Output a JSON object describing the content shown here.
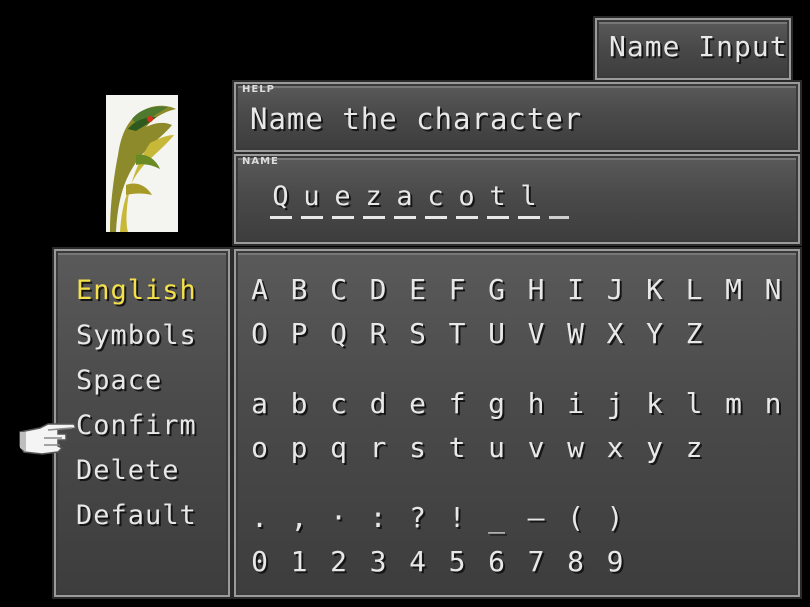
{
  "title": {
    "label": "Name Input"
  },
  "help": {
    "tag": "HELP",
    "text": "Name the character"
  },
  "name": {
    "tag": "NAME",
    "chars": [
      "Q",
      "u",
      "e",
      "z",
      "a",
      "c",
      "o",
      "t",
      "l",
      ""
    ]
  },
  "menu": {
    "items": [
      {
        "label": "English",
        "active": true
      },
      {
        "label": "Symbols",
        "active": false
      },
      {
        "label": "Space",
        "active": false
      },
      {
        "label": "Confirm",
        "active": false
      },
      {
        "label": "Delete",
        "active": false
      },
      {
        "label": "Default",
        "active": false
      }
    ],
    "cursor_on": "Confirm"
  },
  "grid": {
    "rows": [
      [
        "A",
        "B",
        "C",
        "D",
        "E",
        "F",
        "G",
        "H",
        "I",
        "J",
        "K",
        "L",
        "M",
        "N"
      ],
      [
        "O",
        "P",
        "Q",
        "R",
        "S",
        "T",
        "U",
        "V",
        "W",
        "X",
        "Y",
        "Z"
      ],
      [
        "a",
        "b",
        "c",
        "d",
        "e",
        "f",
        "g",
        "h",
        "i",
        "j",
        "k",
        "l",
        "m",
        "n"
      ],
      [
        "o",
        "p",
        "q",
        "r",
        "s",
        "t",
        "u",
        "v",
        "w",
        "x",
        "y",
        "z"
      ],
      [
        ".",
        ",",
        "·",
        ":",
        "?",
        "!",
        "_",
        "–",
        "(",
        ")"
      ],
      [
        "0",
        "1",
        "2",
        "3",
        "4",
        "5",
        "6",
        "7",
        "8",
        "9"
      ]
    ]
  },
  "colors": {
    "active_item": "#f4e04a",
    "text": "#e8e8e8",
    "window": "#4a4a4a"
  }
}
